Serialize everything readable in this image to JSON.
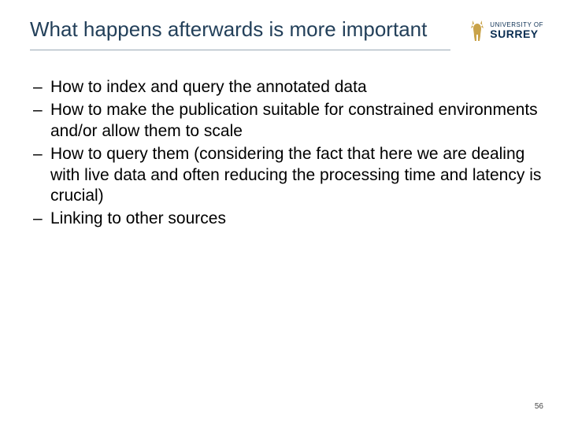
{
  "header": {
    "title": "What happens afterwards is more important"
  },
  "logo": {
    "top": "UNIVERSITY OF",
    "bottom": "SURREY",
    "icon_name": "stag-icon",
    "accent_color": "#c9a34a"
  },
  "bullets": {
    "dash": "–",
    "items": [
      "How to index and query the annotated data",
      "How to make the publication suitable for constrained environments and/or allow them to scale",
      "How to query them (considering the fact that here we are dealing with live data and often reducing the processing time and latency is crucial)",
      "Linking to other sources"
    ]
  },
  "page_number": "56"
}
